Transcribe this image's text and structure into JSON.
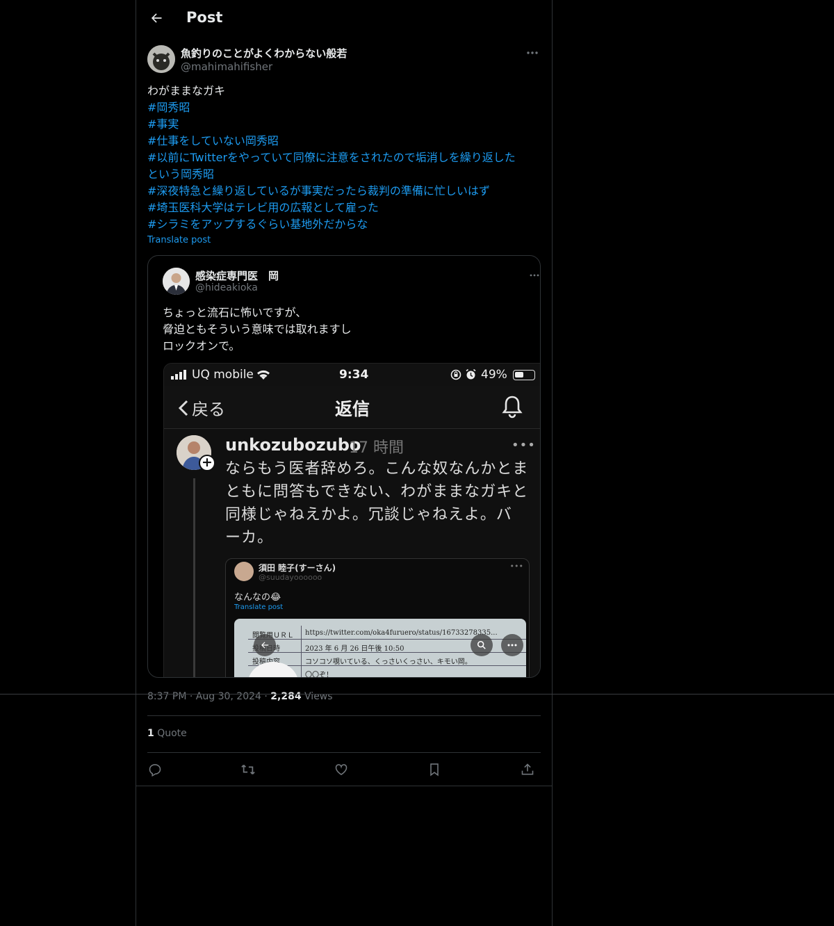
{
  "header": {
    "title": "Post"
  },
  "post": {
    "author_name": "魚釣りのことがよくわからない般若",
    "author_handle": "@mahimahifisher",
    "text_first": "わがままなガキ",
    "hashtags": [
      "#岡秀昭",
      "#事実",
      "#仕事をしていない岡秀昭",
      "#以前にTwitterをやっていて同僚に注意をされたので垢消しを繰り返した",
      "という岡秀昭",
      "#深夜特急と繰り返しているが事実だったら裁判の準備に忙しいはず",
      "#埼玉医科大学はテレビ用の広報として雇った",
      "#シラミをアップするぐらい基地外だからな"
    ],
    "translate": "Translate post",
    "time": "8:37 PM",
    "date": "Aug 30, 2024",
    "sep": "·",
    "views_count": "2,284",
    "views_label": "Views",
    "quote_count": "1",
    "quote_label": "Quote"
  },
  "quoted": {
    "name": "感染症専門医　岡",
    "handle": "@hideakioka",
    "lines": [
      "ちょっと流石に怖いですが、",
      "脅迫ともそういう意味では取れますし",
      "ロックオンで。"
    ]
  },
  "screenshot": {
    "carrier": "UQ mobile",
    "time": "9:34",
    "battery": "49%",
    "battery_level": 0.49,
    "back": "戻る",
    "title": "返信",
    "reply_user": "unkozubozubo",
    "reply_time": "17 時間",
    "reply_more": "•••",
    "reply_lines": [
      "ならもう医者辞めろ。こんな奴なんかとま",
      "ともに問答もできない、わがままなガキと",
      "同様じゃねえかよ。冗談じゃねえよ。バ",
      "ーカ。"
    ],
    "inner_name": "須田 睦子(すーさん)",
    "inner_handle": "@suudayoooooo",
    "inner_more": "•••",
    "inner_text": "なんなの😂",
    "inner_translate": "Translate post",
    "doc_rows": [
      {
        "label": "閲覧用ＵＲＬ",
        "value": "https://twitter.com/oka4furuero/status/16733278335..."
      },
      {
        "label": "投稿日時",
        "value": "2023 年 6 月 26 日午後 10:50"
      },
      {
        "label": "投稿内容",
        "value": "コソコソ覗いている、くっさいくっさい、キモい岡。"
      },
      {
        "label": "",
        "value": "〇〇ぞ！"
      }
    ]
  },
  "icons": {
    "back": "arrow-left-icon",
    "more": "more-horizontal-icon",
    "reply": "reply-icon",
    "repost": "repost-icon",
    "like": "heart-icon",
    "bookmark": "bookmark-icon",
    "share": "share-icon"
  },
  "colors": {
    "background": "#000000",
    "accent": "#1d9bf0",
    "secondary_text": "#71767b",
    "border": "#2f3336"
  }
}
